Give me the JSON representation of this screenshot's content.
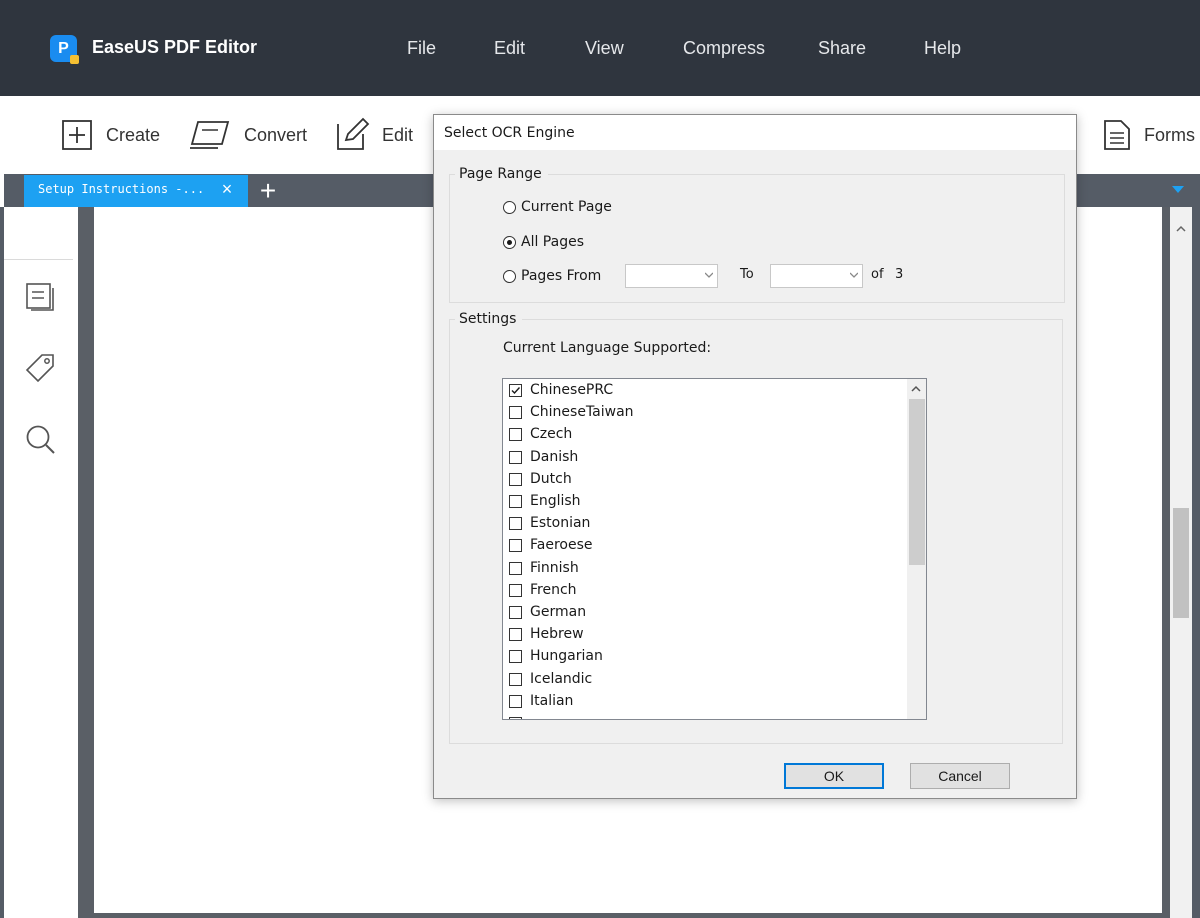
{
  "app": {
    "title": "EaseUS PDF Editor",
    "logo_letter": "P",
    "menu": [
      "File",
      "Edit",
      "View",
      "Compress",
      "Share",
      "Help"
    ]
  },
  "toolbar": {
    "create_label": "Create",
    "convert_label": "Convert",
    "edit_label": "Edit",
    "forms_label": "Forms"
  },
  "tabs": {
    "active_tab_label": "Setup Instructions -...",
    "close_glyph": "×",
    "add_glyph": "+"
  },
  "sidebar": {
    "icons": [
      "pages-icon",
      "bookmark-tag-icon",
      "search-icon"
    ]
  },
  "dialog": {
    "title": "Select OCR Engine",
    "page_range": {
      "group_title": "Page Range",
      "options": [
        "Current Page",
        "All Pages",
        "Pages From"
      ],
      "selected": "All Pages",
      "from_value": "",
      "to_label": "To",
      "to_value": "",
      "of_label": "of",
      "total_pages": "3"
    },
    "settings": {
      "group_title": "Settings",
      "caption": "Current Language Supported:",
      "languages": [
        {
          "name": "ChinesePRC",
          "checked": true
        },
        {
          "name": "ChineseTaiwan",
          "checked": false
        },
        {
          "name": "Czech",
          "checked": false
        },
        {
          "name": "Danish",
          "checked": false
        },
        {
          "name": "Dutch",
          "checked": false
        },
        {
          "name": "English",
          "checked": false
        },
        {
          "name": "Estonian",
          "checked": false
        },
        {
          "name": "Faeroese",
          "checked": false
        },
        {
          "name": "Finnish",
          "checked": false
        },
        {
          "name": "French",
          "checked": false
        },
        {
          "name": "German",
          "checked": false
        },
        {
          "name": "Hebrew",
          "checked": false
        },
        {
          "name": "Hungarian",
          "checked": false
        },
        {
          "name": "Icelandic",
          "checked": false
        },
        {
          "name": "Italian",
          "checked": false
        }
      ]
    },
    "ok_label": "OK",
    "cancel_label": "Cancel"
  },
  "colors": {
    "titlebar": "#2f353e",
    "accent": "#1da1f2",
    "focus_border": "#0078d7"
  }
}
